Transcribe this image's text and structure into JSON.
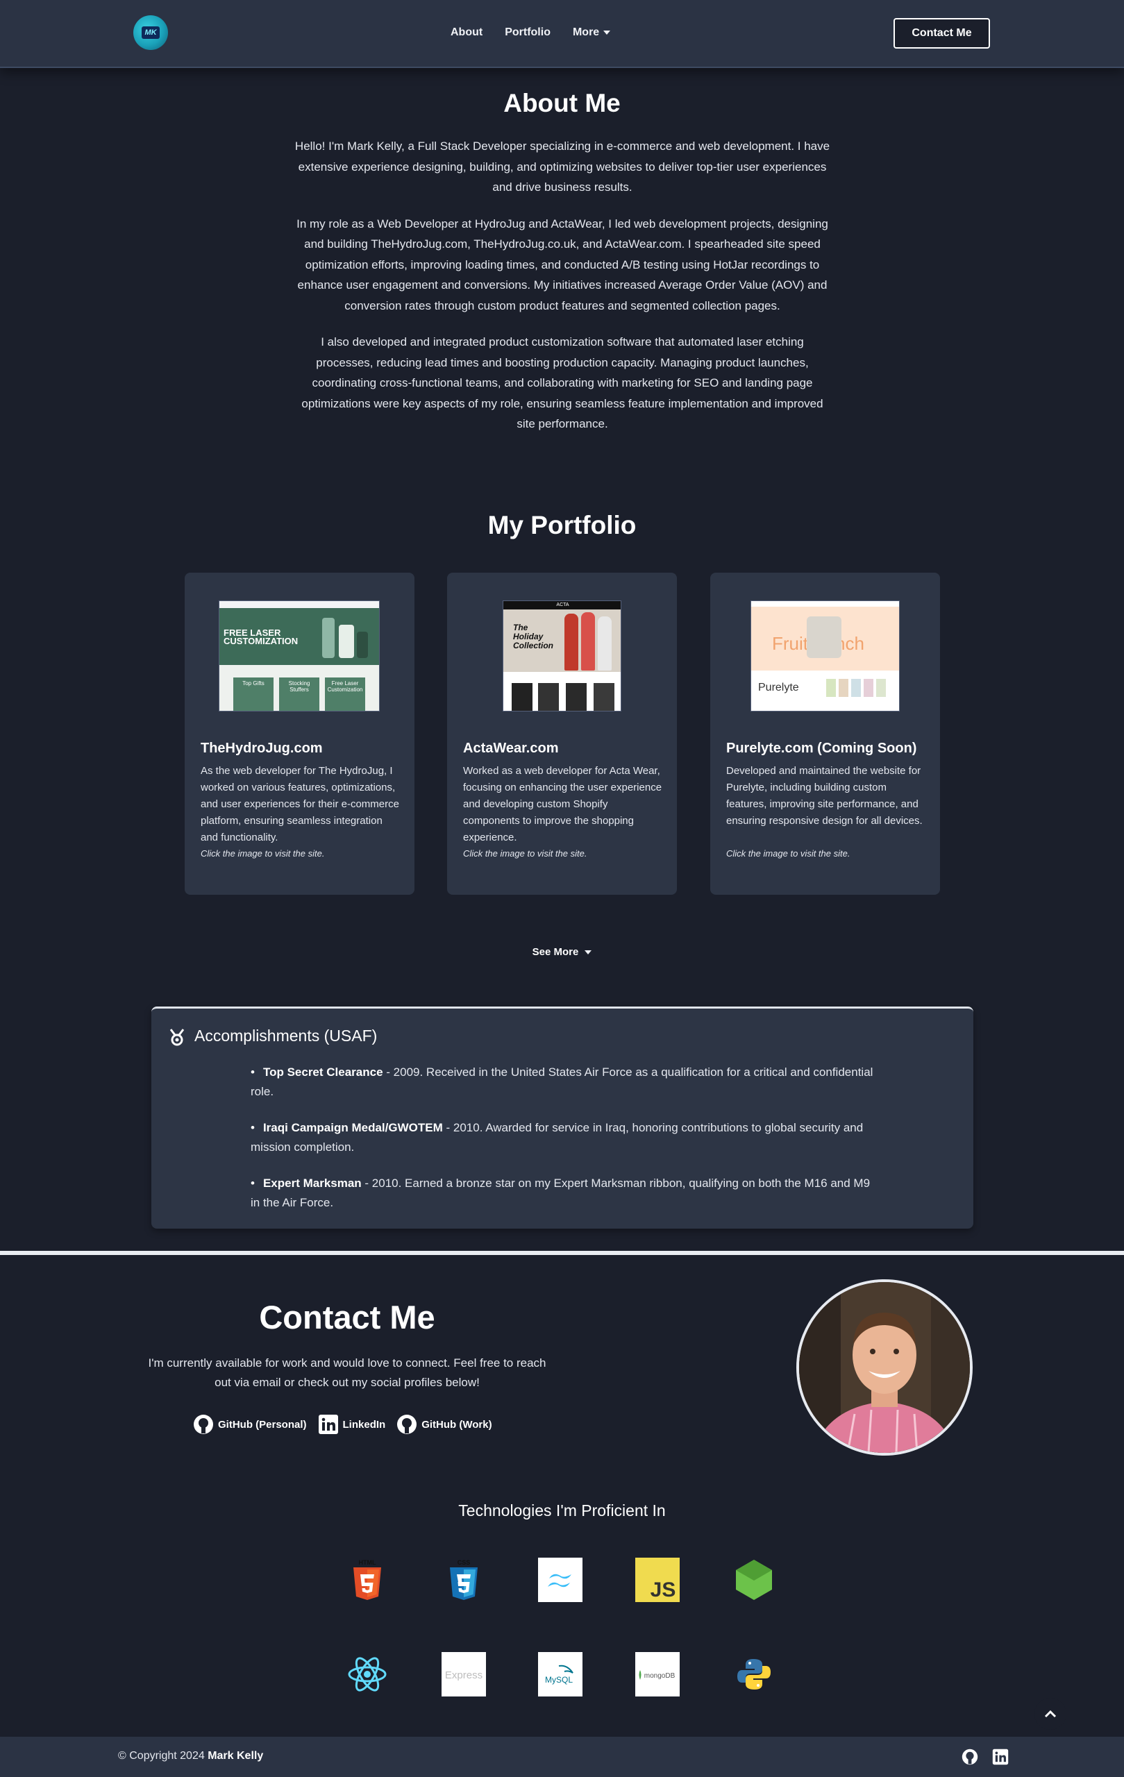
{
  "nav": {
    "logo_text": "MK",
    "links": [
      "About",
      "Portfolio",
      "More"
    ],
    "contact_button": "Contact Me"
  },
  "about": {
    "title": "About Me",
    "paragraphs": [
      "Hello! I'm Mark Kelly, a Full Stack Developer specializing in e-commerce and web development. I have extensive experience designing, building, and optimizing websites to deliver top-tier user experiences and drive business results.",
      "In my role as a Web Developer at HydroJug and ActaWear, I led web development projects, designing and building TheHydroJug.com, TheHydroJug.co.uk, and ActaWear.com. I spearheaded site speed optimization efforts, improving loading times, and conducted A/B testing using HotJar recordings to enhance user engagement and conversions. My initiatives increased Average Order Value (AOV) and conversion rates through custom product features and segmented collection pages.",
      "I also developed and integrated product customization software that automated laser etching processes, reducing lead times and boosting production capacity. Managing product launches, coordinating cross-functional teams, and collaborating with marketing for SEO and landing page optimizations were key aspects of my role, ensuring seamless feature implementation and improved site performance."
    ]
  },
  "portfolio": {
    "title": "My Portfolio",
    "cards": [
      {
        "title": "TheHydroJug.com",
        "description": "As the web developer for The HydroJug, I worked on various features, optimizations, and user experiences for their e-commerce platform, ensuring seamless integration and functionality.",
        "hint": "Click the image to visit the site.",
        "thumb_headline": "FREE LASER CUSTOMIZATION",
        "thumb_tiles": [
          "Top Gifts",
          "Stocking Stuffers",
          "Free Laser Customization"
        ]
      },
      {
        "title": "ActaWear.com",
        "description": "Worked as a web developer for Acta Wear, focusing on enhancing the user experience and developing custom Shopify components to improve the shopping experience.",
        "hint": "Click the image to visit the site.",
        "thumb_headline": "The Holiday Collection",
        "thumb_brand": "ACTA"
      },
      {
        "title": "Purelyte.com (Coming Soon)",
        "description": "Developed and maintained the website for Purelyte, including building custom features, improving site performance, and ensuring responsive design for all devices.",
        "hint": "Click the image to visit the site.",
        "thumb_headline": "Fruit Punch",
        "thumb_brand": "Purelyte"
      }
    ],
    "see_more": "See More"
  },
  "accomplishments": {
    "title": "Accomplishments (USAF)",
    "items": [
      {
        "bold": "Top Secret Clearance",
        "text": " - 2009. Received in the United States Air Force as a qualification for a critical and confidential role."
      },
      {
        "bold": "Iraqi Campaign Medal/GWOTEM",
        "text": " - 2010. Awarded for service in Iraq, honoring contributions to global security and mission completion."
      },
      {
        "bold": "Expert Marksman",
        "text": " - 2010. Earned a bronze star on my Expert Marksman ribbon, qualifying on both the M16 and M9 in the Air Force."
      }
    ]
  },
  "contact": {
    "title": "Contact Me",
    "text": "I'm currently available for work and would love to connect. Feel free to reach out via email or check out my social profiles below!",
    "links": [
      "GitHub (Personal)",
      "LinkedIn",
      "GitHub (Work)"
    ]
  },
  "technologies": {
    "title": "Technologies I'm Proficient In",
    "items": [
      "html5-icon",
      "css3-icon",
      "tailwind-icon",
      "javascript-icon",
      "nodejs-icon",
      "react-icon",
      "express-icon",
      "mysql-icon",
      "mongodb-icon",
      "python-icon"
    ],
    "labels": {
      "html": "HTML",
      "css": "CSS",
      "js": "JS",
      "express": "Express",
      "mysql": "MySQL",
      "mongo": "mongoDB"
    }
  },
  "footer": {
    "copyright_prefix": "© Copyright 2024 ",
    "name": "Mark Kelly"
  },
  "colors": {
    "background": "#1b1f2b",
    "nav": "#2b3344",
    "card": "#2d3545"
  }
}
